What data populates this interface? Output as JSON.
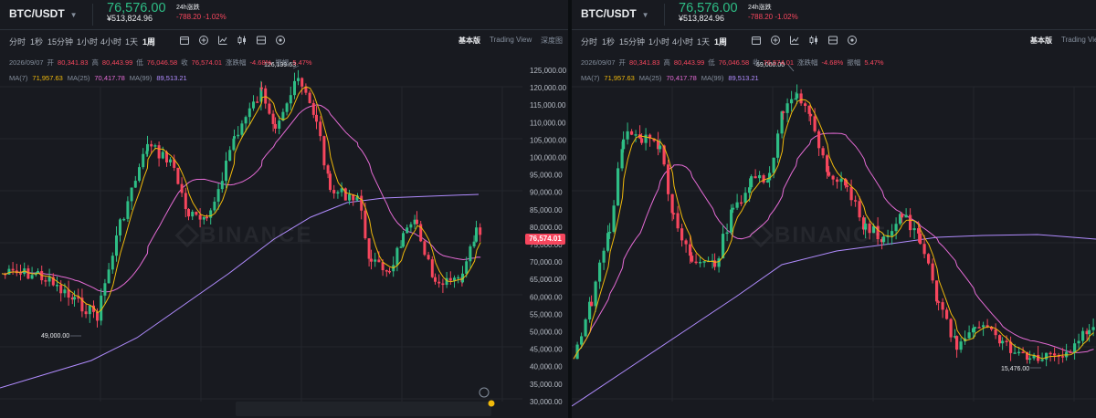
{
  "colors": {
    "up": "#2ebd85",
    "down": "#f6465d",
    "ma7": "#f0b90b",
    "ma25": "#e56bd5",
    "ma99": "#b18cff",
    "bg": "#181a20"
  },
  "header": {
    "pair": "BTC/USDT",
    "last_price": "76,576.00",
    "cny_price": "¥513,824.96",
    "change_label": "24h涨跌",
    "change_value": "-788.20 -1.02%"
  },
  "toolbar": {
    "timeframes": [
      "分时",
      "1秒",
      "15分钟",
      "1小时",
      "4小时",
      "1天",
      "1周"
    ],
    "active_timeframe": "1周",
    "tool_icons": [
      "calendar-icon",
      "add-indicator-icon",
      "chart-type-icon",
      "candle-settings-icon",
      "layout-icon",
      "replay-icon"
    ],
    "views": [
      "基本版",
      "Trading View",
      "深度图"
    ],
    "active_view": "基本版"
  },
  "candle_info": {
    "date": "2026/09/07",
    "open_label": "开",
    "open": "80,341.83",
    "high_label": "高",
    "high": "80,443.99",
    "low_label": "低",
    "low": "76,046.58",
    "close_label": "收",
    "close": "76,574.01",
    "change_label": "涨跌幅",
    "change": "-4.68%",
    "amp_label": "振幅",
    "amp": "5.47%"
  },
  "ma": {
    "ma7_label": "MA(7)",
    "ma7": "71,957.63",
    "ma25_label": "MA(25)",
    "ma25": "70,417.78",
    "ma99_label": "MA(99)",
    "ma99": "89,513.21"
  },
  "left_chart": {
    "price_tag": "76,574.01",
    "y_ticks": [
      "125,000.00",
      "120,000.00",
      "115,000.00",
      "110,000.00",
      "105,000.00",
      "100,000.00",
      "95,000.00",
      "90,000.00",
      "85,000.00",
      "80,000.00",
      "75,000.00",
      "70,000.00",
      "65,000.00",
      "60,000.00",
      "55,000.00",
      "50,000.00",
      "45,000.00",
      "40,000.00",
      "35,000.00",
      "30,000.00"
    ],
    "high_marker": "126,199.63",
    "low_marker": "49,000.00",
    "watermark": "BINANCE"
  },
  "right_chart": {
    "high_marker": "69,000.00",
    "low_marker": "15,476.00",
    "watermark": "BINANCE"
  }
}
